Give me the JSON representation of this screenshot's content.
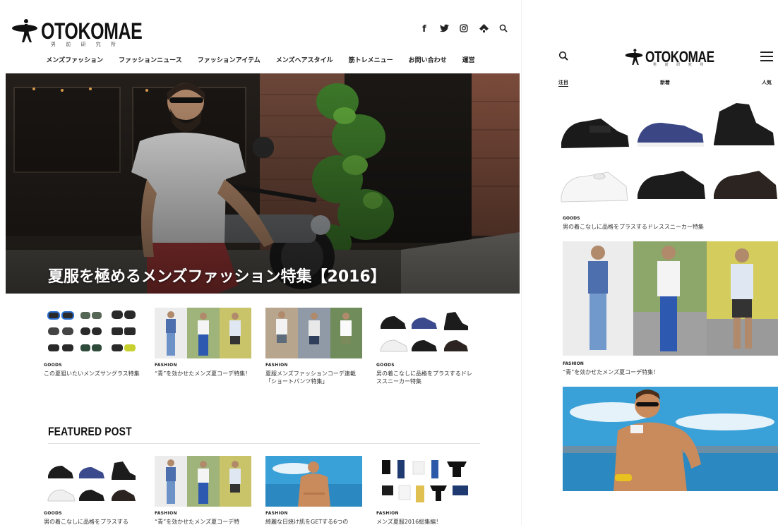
{
  "brand": {
    "name": "OTOKOMAE",
    "sub": "男 前 研 究 所"
  },
  "desktop": {
    "social_icons": [
      "facebook-icon",
      "twitter-icon",
      "instagram-icon",
      "feedly-icon",
      "search-icon"
    ],
    "social_glyphs": [
      "f",
      "t",
      "◎",
      "◆",
      "⌕"
    ],
    "nav": [
      "メンズファッション",
      "ファッションニュース",
      "ファッションアイテム",
      "メンズヘアスタイル",
      "筋トレメニュー",
      "お問い合わせ",
      "運営"
    ],
    "hero_title": "夏服を極めるメンズファッション特集【2016】",
    "row1": [
      {
        "category": "GOODS",
        "title": "この夏狙いたいメンズサングラス特集"
      },
      {
        "category": "FASHION",
        "title": "“青”を効かせたメンズ夏コーデ特集！"
      },
      {
        "category": "FASHION",
        "title": "夏服メンズファッションコーデ連載「ショートパンツ特集」"
      },
      {
        "category": "GOODS",
        "title": "男の着こなしに品格をプラスするドレススニーカー特集"
      }
    ],
    "featured_heading": "FEATURED POST",
    "row2": [
      {
        "category": "GOODS",
        "title": "男の着こなしに品格をプラスする"
      },
      {
        "category": "FASHION",
        "title": "“青”を効かせたメンズ夏コーデ特"
      },
      {
        "category": "FASHION",
        "title": "綺麗な日焼け肌をGETする6つの"
      },
      {
        "category": "FASHION",
        "title": "メンズ夏服2016総集編！"
      }
    ]
  },
  "mobile": {
    "tabs": [
      "注目",
      "新着",
      "人気"
    ],
    "post1": {
      "category": "GOODS",
      "title": "男の着こなしに品格をプラスするドレススニーカー特集"
    },
    "post2": {
      "category": "FASHION",
      "title": "“青”を効かせたメンズ夏コーデ特集！"
    }
  },
  "colors": {
    "accent": "#111111",
    "sky": "#3aa0d8",
    "denim": "#2f5fa8"
  }
}
